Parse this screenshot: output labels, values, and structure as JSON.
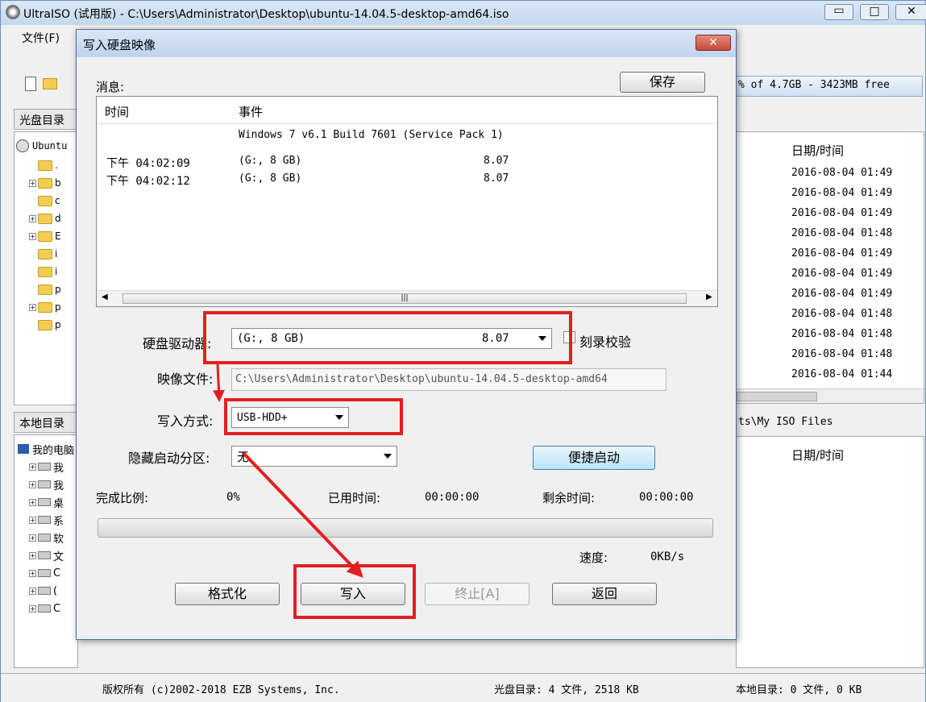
{
  "app": {
    "title_partial": "UltraISO (试用版) - C:\\Users\\Administrator\\Desktop\\ubuntu-14.04.5-desktop-amd64.iso",
    "menu_file": "文件(F)",
    "capacity_text": "% of 4.7GB - 3423MB free",
    "iso_tree_label": "光盘目录",
    "iso_root": "Ubuntu",
    "local_tree_label": "本地目录",
    "local_root": "我的电脑",
    "local_path": "ts\\My ISO Files",
    "date_header": "日期/时间",
    "dates": [
      "2016-08-04 01:49",
      "2016-08-04 01:49",
      "2016-08-04 01:49",
      "2016-08-04 01:48",
      "2016-08-04 01:49",
      "2016-08-04 01:49",
      "2016-08-04 01:49",
      "2016-08-04 01:48",
      "2016-08-04 01:48",
      "2016-08-04 01:48",
      "2016-08-04 01:44"
    ],
    "tree_items": [
      ". ",
      "b",
      "c",
      "d",
      "E",
      "i",
      "i",
      "p",
      "p",
      "p"
    ],
    "local_items": [
      "我",
      "我",
      "桌",
      "系",
      "软",
      "文",
      "C",
      "(",
      "C"
    ],
    "status": {
      "copyright": "版权所有 (c)2002-2018 EZB Systems, Inc.",
      "iso_dir": "光盘目录: 4 文件, 2518 KB",
      "local_dir": "本地目录: 0 文件, 0 KB"
    }
  },
  "dialog": {
    "title": "写入硬盘映像",
    "message_label": "消息:",
    "save_button": "保存",
    "log_headers": [
      "时间",
      "事件"
    ],
    "log_rows": [
      {
        "time": "",
        "event": "Windows 7 v6.1 Build 7601 (Service Pack 1)",
        "value": ""
      },
      {
        "time": "下午 04:02:09",
        "event": "(G:, 8 GB)",
        "value": "8.07"
      },
      {
        "time": "下午 04:02:12",
        "event": "(G:, 8 GB)",
        "value": "8.07"
      }
    ],
    "disk_drive_label": "硬盘驱动器:",
    "disk_drive_value": "(G:, 8 GB)",
    "disk_drive_size": "8.07",
    "verify_label": "刻录校验",
    "image_file_label": "映像文件:",
    "image_file_value": "C:\\Users\\Administrator\\Desktop\\ubuntu-14.04.5-desktop-amd64",
    "write_method_label": "写入方式:",
    "write_method_value": "USB-HDD+",
    "hidden_partition_label": "隐藏启动分区:",
    "hidden_partition_value": "无",
    "quick_boot_button": "便捷启动",
    "done_ratio_label": "完成比例:",
    "done_ratio_value": "0%",
    "elapsed_label": "已用时间:",
    "elapsed_value": "00:00:00",
    "remaining_label": "剩余时间:",
    "remaining_value": "00:00:00",
    "progress": 0,
    "speed_label": "速度:",
    "speed_value": "0KB/s",
    "format_button": "格式化",
    "write_button": "写入",
    "abort_button": "终止[A]",
    "back_button": "返回"
  },
  "colors": {
    "highlight": "#e02020",
    "title_bar": "#c9dcf3",
    "close_button": "#c75050"
  }
}
